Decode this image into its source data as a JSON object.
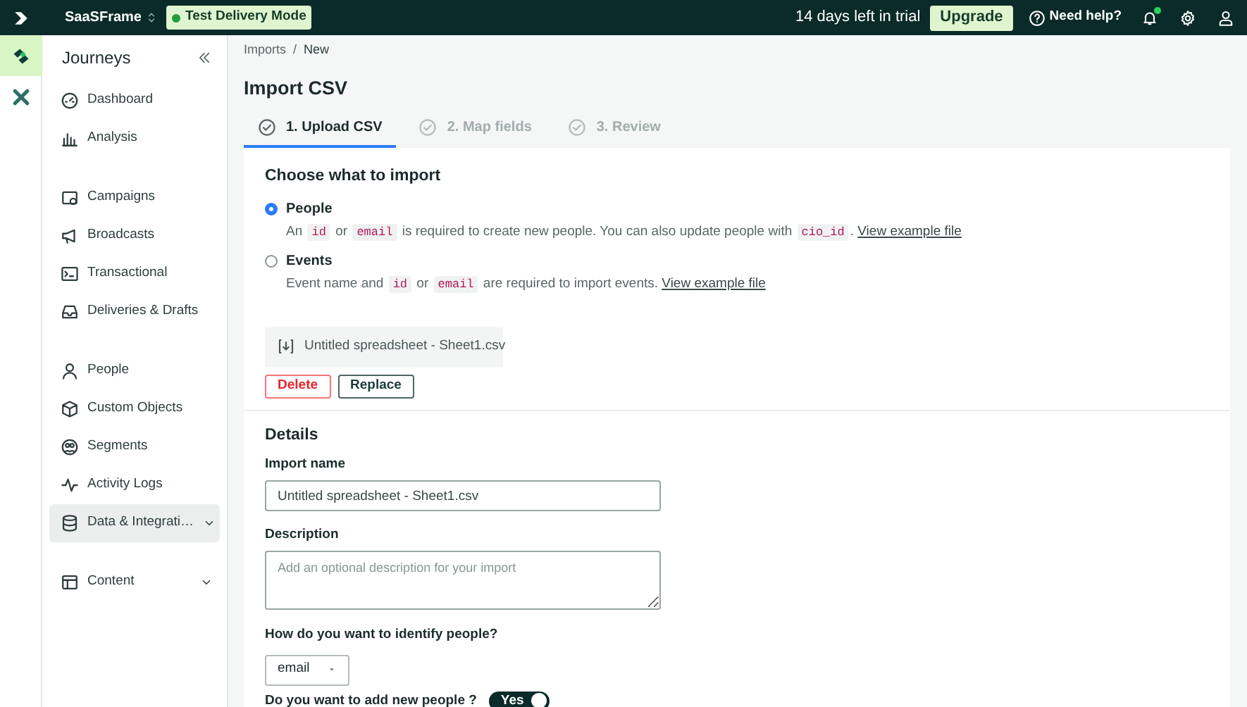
{
  "topbar": {
    "workspace": "SaaSFrame",
    "mode_badge": "Test Delivery Mode",
    "trial": "14 days left in trial",
    "upgrade": "Upgrade",
    "help": "Need help?",
    "notification_dot": true
  },
  "rail": [
    {
      "kind": "journeys",
      "selected": true
    },
    {
      "kind": "integrations",
      "selected": false
    }
  ],
  "sidebar": {
    "title": "Journeys",
    "groups": [
      [
        {
          "kind": "dashboard",
          "label": "Dashboard",
          "selected": false
        },
        {
          "kind": "analysis",
          "label": "Analysis",
          "selected": false
        }
      ],
      [
        {
          "kind": "campaigns",
          "label": "Campaigns",
          "selected": false
        },
        {
          "kind": "broadcasts",
          "label": "Broadcasts",
          "selected": false
        },
        {
          "kind": "transactional",
          "label": "Transactional",
          "selected": false
        },
        {
          "kind": "deliveries",
          "label": "Deliveries & Drafts",
          "selected": false
        }
      ],
      [
        {
          "kind": "people",
          "label": "People",
          "selected": false
        },
        {
          "kind": "objects",
          "label": "Custom Objects",
          "selected": false
        },
        {
          "kind": "segments",
          "label": "Segments",
          "selected": false
        },
        {
          "kind": "activity",
          "label": "Activity Logs",
          "selected": false
        },
        {
          "kind": "data",
          "label": "Data & Integrati…",
          "selected": true,
          "expandable": true
        }
      ],
      [
        {
          "kind": "content",
          "label": "Content",
          "selected": false,
          "expandable": true
        }
      ]
    ]
  },
  "breadcrumb": [
    "Imports",
    "/",
    "New"
  ],
  "title": "Import CSV",
  "steps": [
    {
      "label": "1. Upload CSV",
      "selected": true
    },
    {
      "label": "2. Map fields",
      "selected": false
    },
    {
      "label": "3. Review",
      "selected": false
    }
  ],
  "import_type": {
    "heading": "Choose what to import",
    "options": [
      {
        "label": "People",
        "selected": true,
        "description": [
          {
            "kind": "text",
            "text": "An "
          },
          {
            "kind": "code",
            "text": "id"
          },
          {
            "kind": "text",
            "text": " or "
          },
          {
            "kind": "code",
            "text": "email"
          },
          {
            "kind": "text",
            "text": " is required to create new people. You can also update people with "
          },
          {
            "kind": "code",
            "text": "cio_id"
          },
          {
            "kind": "text",
            "text": ". "
          },
          {
            "kind": "link",
            "text": "View example file"
          }
        ]
      },
      {
        "label": "Events",
        "selected": false,
        "description": [
          {
            "kind": "text",
            "text": "Event name and "
          },
          {
            "kind": "code",
            "text": "id"
          },
          {
            "kind": "text",
            "text": " or "
          },
          {
            "kind": "code",
            "text": "email"
          },
          {
            "kind": "text",
            "text": " are required to import events. "
          },
          {
            "kind": "link",
            "text": "View example file"
          }
        ]
      }
    ]
  },
  "file": {
    "name": "Untitled spreadsheet - Sheet1.csv",
    "buttons": [
      {
        "kind": "danger",
        "label": "Delete"
      },
      {
        "kind": "outline",
        "label": "Replace"
      }
    ]
  },
  "details": {
    "heading": "Details",
    "import_name_label": "Import name",
    "import_name_value": "Untitled spreadsheet - Sheet1.csv",
    "description_label": "Description",
    "description_placeholder": "Add an optional description for your import",
    "identify_label": "How do you want to identify people?",
    "identify_value": "email",
    "add_people_label": "Do you want to add new people ?",
    "add_people_toggle": {
      "label": "Yes",
      "on": true
    }
  }
}
